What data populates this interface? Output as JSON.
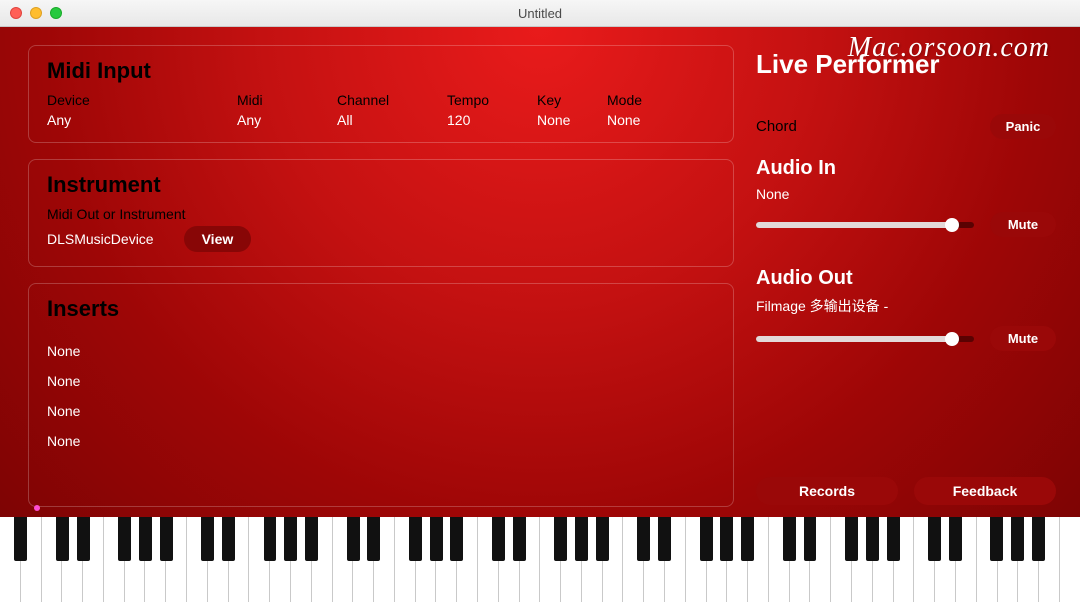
{
  "window": {
    "title": "Untitled"
  },
  "watermark": "Mac.orsoon.com",
  "midi": {
    "section_title": "Midi Input",
    "headers": {
      "device": "Device",
      "midi": "Midi",
      "channel": "Channel",
      "tempo": "Tempo",
      "key": "Key",
      "mode": "Mode"
    },
    "values": {
      "device": "Any",
      "midi": "Any",
      "channel": "All",
      "tempo": "120",
      "key": "None",
      "mode": "None"
    }
  },
  "instrument": {
    "section_title": "Instrument",
    "label": "Midi Out or Instrument",
    "value": "DLSMusicDevice",
    "view_btn": "View"
  },
  "inserts": {
    "section_title": "Inserts",
    "items": [
      "None",
      "None",
      "None",
      "None"
    ]
  },
  "live": {
    "title": "Live Performer",
    "chord_label": "Chord",
    "panic_btn": "Panic",
    "audio_in": {
      "title": "Audio In",
      "value": "None",
      "mute_btn": "Mute"
    },
    "audio_out": {
      "title": "Audio Out",
      "value": "Filmage 多输出设备 -",
      "mute_btn": "Mute"
    },
    "records_btn": "Records",
    "feedback_btn": "Feedback"
  }
}
